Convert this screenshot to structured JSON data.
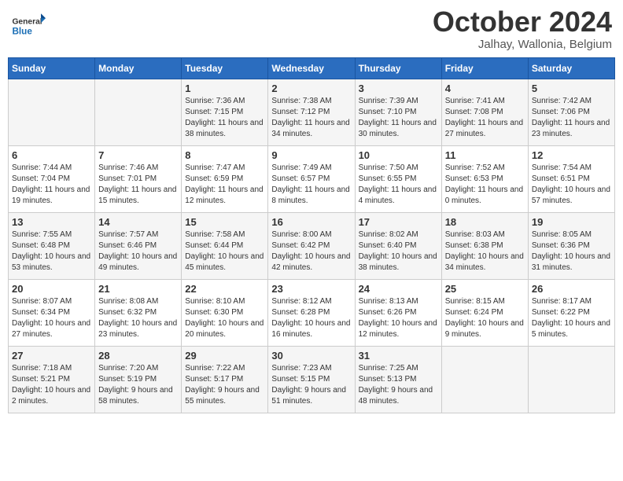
{
  "header": {
    "logo_general": "General",
    "logo_blue": "Blue",
    "month": "October 2024",
    "location": "Jalhay, Wallonia, Belgium"
  },
  "days_of_week": [
    "Sunday",
    "Monday",
    "Tuesday",
    "Wednesday",
    "Thursday",
    "Friday",
    "Saturday"
  ],
  "weeks": [
    [
      {
        "day": "",
        "info": ""
      },
      {
        "day": "",
        "info": ""
      },
      {
        "day": "1",
        "info": "Sunrise: 7:36 AM\nSunset: 7:15 PM\nDaylight: 11 hours and 38 minutes."
      },
      {
        "day": "2",
        "info": "Sunrise: 7:38 AM\nSunset: 7:12 PM\nDaylight: 11 hours and 34 minutes."
      },
      {
        "day": "3",
        "info": "Sunrise: 7:39 AM\nSunset: 7:10 PM\nDaylight: 11 hours and 30 minutes."
      },
      {
        "day": "4",
        "info": "Sunrise: 7:41 AM\nSunset: 7:08 PM\nDaylight: 11 hours and 27 minutes."
      },
      {
        "day": "5",
        "info": "Sunrise: 7:42 AM\nSunset: 7:06 PM\nDaylight: 11 hours and 23 minutes."
      }
    ],
    [
      {
        "day": "6",
        "info": "Sunrise: 7:44 AM\nSunset: 7:04 PM\nDaylight: 11 hours and 19 minutes."
      },
      {
        "day": "7",
        "info": "Sunrise: 7:46 AM\nSunset: 7:01 PM\nDaylight: 11 hours and 15 minutes."
      },
      {
        "day": "8",
        "info": "Sunrise: 7:47 AM\nSunset: 6:59 PM\nDaylight: 11 hours and 12 minutes."
      },
      {
        "day": "9",
        "info": "Sunrise: 7:49 AM\nSunset: 6:57 PM\nDaylight: 11 hours and 8 minutes."
      },
      {
        "day": "10",
        "info": "Sunrise: 7:50 AM\nSunset: 6:55 PM\nDaylight: 11 hours and 4 minutes."
      },
      {
        "day": "11",
        "info": "Sunrise: 7:52 AM\nSunset: 6:53 PM\nDaylight: 11 hours and 0 minutes."
      },
      {
        "day": "12",
        "info": "Sunrise: 7:54 AM\nSunset: 6:51 PM\nDaylight: 10 hours and 57 minutes."
      }
    ],
    [
      {
        "day": "13",
        "info": "Sunrise: 7:55 AM\nSunset: 6:48 PM\nDaylight: 10 hours and 53 minutes."
      },
      {
        "day": "14",
        "info": "Sunrise: 7:57 AM\nSunset: 6:46 PM\nDaylight: 10 hours and 49 minutes."
      },
      {
        "day": "15",
        "info": "Sunrise: 7:58 AM\nSunset: 6:44 PM\nDaylight: 10 hours and 45 minutes."
      },
      {
        "day": "16",
        "info": "Sunrise: 8:00 AM\nSunset: 6:42 PM\nDaylight: 10 hours and 42 minutes."
      },
      {
        "day": "17",
        "info": "Sunrise: 8:02 AM\nSunset: 6:40 PM\nDaylight: 10 hours and 38 minutes."
      },
      {
        "day": "18",
        "info": "Sunrise: 8:03 AM\nSunset: 6:38 PM\nDaylight: 10 hours and 34 minutes."
      },
      {
        "day": "19",
        "info": "Sunrise: 8:05 AM\nSunset: 6:36 PM\nDaylight: 10 hours and 31 minutes."
      }
    ],
    [
      {
        "day": "20",
        "info": "Sunrise: 8:07 AM\nSunset: 6:34 PM\nDaylight: 10 hours and 27 minutes."
      },
      {
        "day": "21",
        "info": "Sunrise: 8:08 AM\nSunset: 6:32 PM\nDaylight: 10 hours and 23 minutes."
      },
      {
        "day": "22",
        "info": "Sunrise: 8:10 AM\nSunset: 6:30 PM\nDaylight: 10 hours and 20 minutes."
      },
      {
        "day": "23",
        "info": "Sunrise: 8:12 AM\nSunset: 6:28 PM\nDaylight: 10 hours and 16 minutes."
      },
      {
        "day": "24",
        "info": "Sunrise: 8:13 AM\nSunset: 6:26 PM\nDaylight: 10 hours and 12 minutes."
      },
      {
        "day": "25",
        "info": "Sunrise: 8:15 AM\nSunset: 6:24 PM\nDaylight: 10 hours and 9 minutes."
      },
      {
        "day": "26",
        "info": "Sunrise: 8:17 AM\nSunset: 6:22 PM\nDaylight: 10 hours and 5 minutes."
      }
    ],
    [
      {
        "day": "27",
        "info": "Sunrise: 7:18 AM\nSunset: 5:21 PM\nDaylight: 10 hours and 2 minutes."
      },
      {
        "day": "28",
        "info": "Sunrise: 7:20 AM\nSunset: 5:19 PM\nDaylight: 9 hours and 58 minutes."
      },
      {
        "day": "29",
        "info": "Sunrise: 7:22 AM\nSunset: 5:17 PM\nDaylight: 9 hours and 55 minutes."
      },
      {
        "day": "30",
        "info": "Sunrise: 7:23 AM\nSunset: 5:15 PM\nDaylight: 9 hours and 51 minutes."
      },
      {
        "day": "31",
        "info": "Sunrise: 7:25 AM\nSunset: 5:13 PM\nDaylight: 9 hours and 48 minutes."
      },
      {
        "day": "",
        "info": ""
      },
      {
        "day": "",
        "info": ""
      }
    ]
  ]
}
